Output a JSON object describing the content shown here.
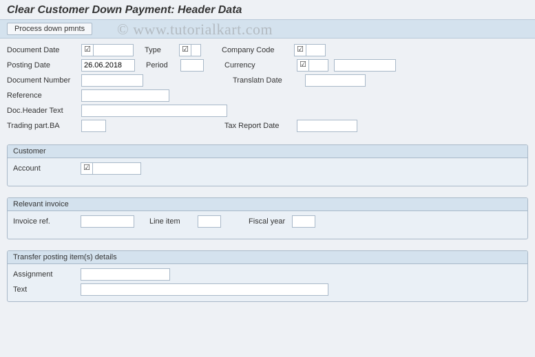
{
  "title": "Clear Customer Down Payment: Header Data",
  "watermark": "© www.tutorialkart.com",
  "toolbar": {
    "process_btn": "Process down pmnts"
  },
  "header": {
    "document_date_label": "Document Date",
    "document_date_value": "",
    "document_date_checked": "☑",
    "posting_date_label": "Posting Date",
    "posting_date_value": "26.06.2018",
    "document_number_label": "Document Number",
    "document_number_value": "",
    "reference_label": "Reference",
    "reference_value": "",
    "doc_header_text_label": "Doc.Header Text",
    "doc_header_text_value": "",
    "trading_part_ba_label": "Trading part.BA",
    "trading_part_ba_value": "",
    "type_label": "Type",
    "type_checked": "☑",
    "period_label": "Period",
    "period_value": "",
    "company_code_label": "Company Code",
    "company_code_checked": "☑",
    "currency_label": "Currency",
    "currency_checked": "☑",
    "currency_value": "",
    "translatn_date_label": "Translatn Date",
    "translatn_date_value": "",
    "tax_report_date_label": "Tax Report Date",
    "tax_report_date_value": ""
  },
  "customer_group": {
    "title": "Customer",
    "account_label": "Account",
    "account_checked": "☑",
    "account_value": ""
  },
  "invoice_group": {
    "title": "Relevant invoice",
    "invoice_ref_label": "Invoice ref.",
    "invoice_ref_value": "",
    "line_item_label": "Line item",
    "line_item_value": "",
    "fiscal_year_label": "Fiscal year",
    "fiscal_year_value": ""
  },
  "transfer_group": {
    "title": "Transfer posting item(s) details",
    "assignment_label": "Assignment",
    "assignment_value": "",
    "text_label": "Text",
    "text_value": ""
  }
}
